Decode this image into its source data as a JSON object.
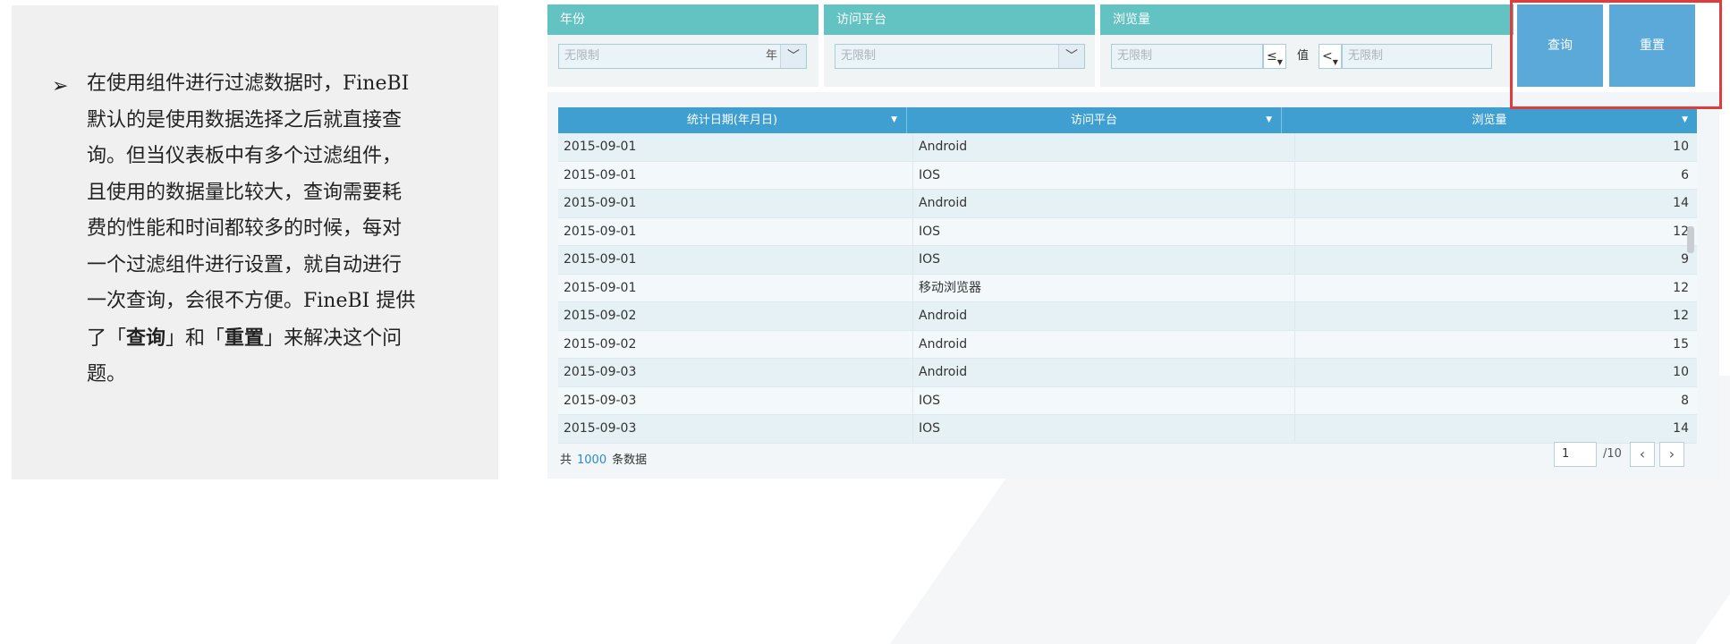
{
  "note": {
    "bullet": "➢",
    "line1": "在使用组件进行过滤数据时，FineBI",
    "line2": "默认的是使用数据选择之后就直接查",
    "line3": "询。但当仪表板中有多个过滤组件，",
    "line4": "且使用的数据量比较大，查询需要耗",
    "line5": "费的性能和时间都较多的时候，每对",
    "line6": "一个过滤组件进行设置，就自动进行",
    "line7": "一次查询，会很不方便。FineBI 提供",
    "line8_pre": "了「",
    "line8_query": "查询",
    "line8_mid": "」和「",
    "line8_reset": "重置",
    "line8_post": "」来解决这个问",
    "line9": "题。"
  },
  "filters": {
    "year": {
      "title": "年份",
      "placeholder": "无限制",
      "unit": "年",
      "arrow": "﹀"
    },
    "platform": {
      "title": "访问平台",
      "placeholder": "无限制",
      "arrow": "﹀"
    },
    "views": {
      "title": "浏览量",
      "placeholder_left": "无限制",
      "op_left": "≤",
      "value_label": "值",
      "op_right": "<",
      "placeholder_right": "无限制"
    }
  },
  "buttons": {
    "query": "查询",
    "reset": "重置"
  },
  "table": {
    "columns": [
      "统计日期(年月日)",
      "访问平台",
      "浏览量"
    ],
    "rows": [
      [
        "2015-09-01",
        "Android",
        "10"
      ],
      [
        "2015-09-01",
        "IOS",
        "6"
      ],
      [
        "2015-09-01",
        "Android",
        "14"
      ],
      [
        "2015-09-01",
        "IOS",
        "12"
      ],
      [
        "2015-09-01",
        "IOS",
        "9"
      ],
      [
        "2015-09-01",
        "移动浏览器",
        "12"
      ],
      [
        "2015-09-02",
        "Android",
        "12"
      ],
      [
        "2015-09-02",
        "Android",
        "15"
      ],
      [
        "2015-09-03",
        "Android",
        "10"
      ],
      [
        "2015-09-03",
        "IOS",
        "8"
      ],
      [
        "2015-09-03",
        "IOS",
        "14"
      ]
    ]
  },
  "footer": {
    "total_prefix": "共",
    "total_count": "1000",
    "total_suffix": "条数据",
    "current_page": "1",
    "total_pages": "/10",
    "prev_icon": "‹",
    "next_icon": "›"
  },
  "colors": {
    "header_teal": "#63c2c2",
    "table_header": "#3f9fd0",
    "button_blue": "#5aa9d9",
    "highlight_red": "#e23b3b"
  }
}
